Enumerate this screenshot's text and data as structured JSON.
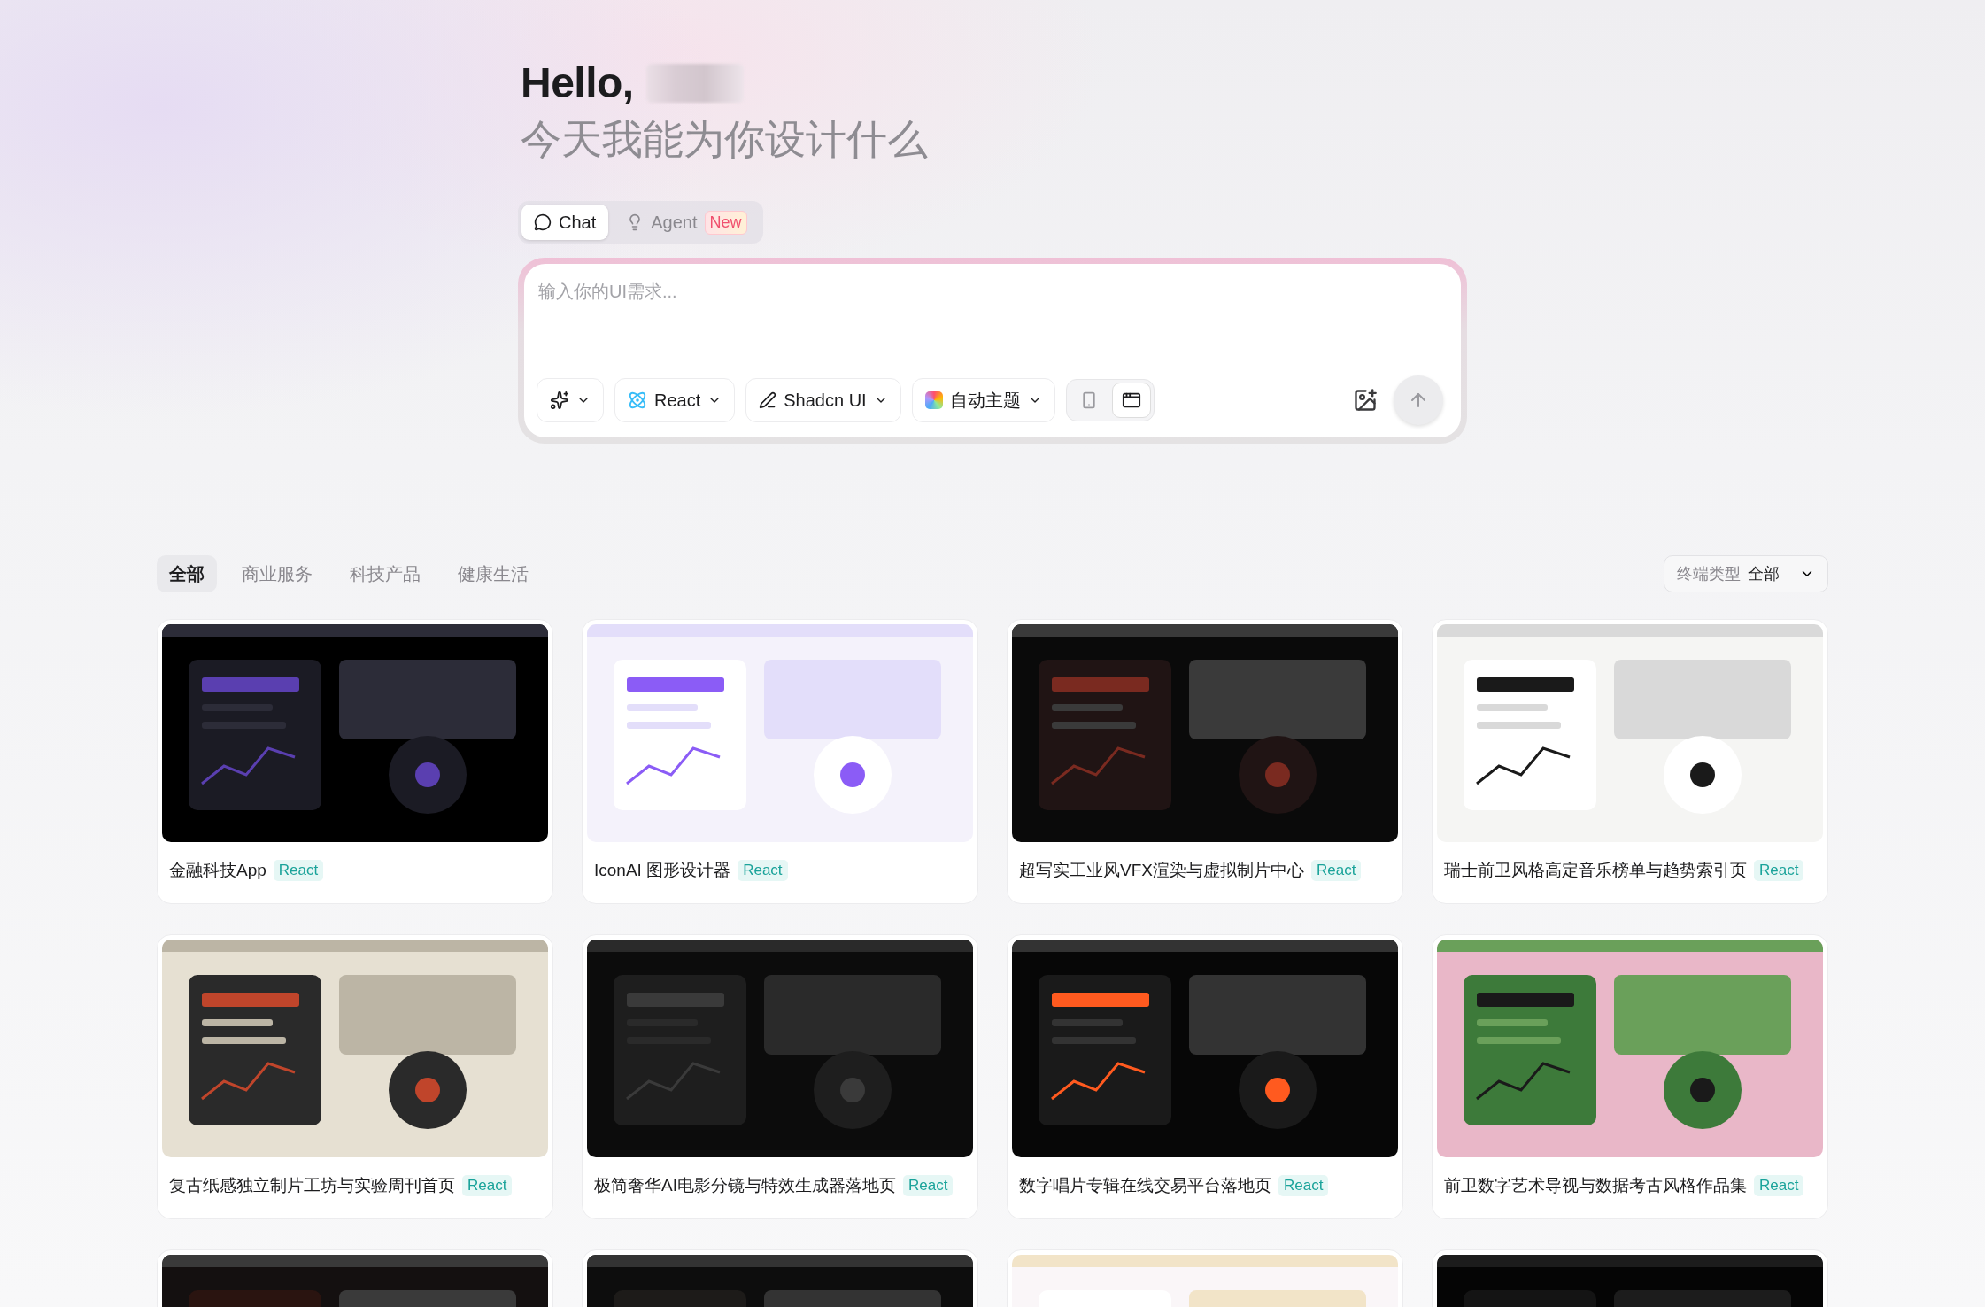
{
  "greeting": {
    "hello": "Hello,",
    "subtitle": "今天我能为你设计什么"
  },
  "modes": [
    {
      "kind": "chat",
      "label": "Chat",
      "selected": true
    },
    {
      "kind": "agent",
      "label": "Agent",
      "badge": "New",
      "selected": false
    }
  ],
  "prompt": {
    "placeholder": "输入你的UI需求...",
    "tools": [
      {
        "kind": "magic"
      },
      {
        "kind": "framework",
        "label": "React"
      },
      {
        "kind": "library",
        "label": "Shadcn UI"
      },
      {
        "kind": "theme",
        "label": "自动主题"
      }
    ],
    "devices": [
      {
        "kind": "mobile",
        "selected": false
      },
      {
        "kind": "desktop",
        "selected": true
      }
    ]
  },
  "categories": [
    {
      "label": "全部",
      "selected": true
    },
    {
      "label": "商业服务",
      "selected": false
    },
    {
      "label": "科技产品",
      "selected": false
    },
    {
      "label": "健康生活",
      "selected": false
    }
  ],
  "device_filter": {
    "label": "终端类型",
    "value": "全部"
  },
  "projects": [
    {
      "kind": "project",
      "title": "金融科技App",
      "tag": "React"
    },
    {
      "kind": "project",
      "title": "IconAI 图形设计器",
      "tag": "React"
    },
    {
      "kind": "project",
      "title": "超写实工业风VFX渲染与虚拟制片中心",
      "tag": "React"
    },
    {
      "kind": "project",
      "title": "瑞士前卫风格高定音乐榜单与趋势索引页",
      "tag": "React"
    },
    {
      "kind": "project",
      "title": "复古纸感独立制片工坊与实验周刊首页",
      "tag": "React"
    },
    {
      "kind": "project",
      "title": "极简奢华AI电影分镜与特效生成器落地页",
      "tag": "React"
    },
    {
      "kind": "project",
      "title": "数字唱片专辑在线交易平台落地页",
      "tag": "React"
    },
    {
      "kind": "project",
      "title": "前卫数字艺术导视与数据考古风格作品集",
      "tag": "React"
    },
    {
      "kind": "picture"
    },
    {
      "kind": "picture"
    },
    {
      "kind": "picture"
    },
    {
      "kind": "picture"
    }
  ]
}
